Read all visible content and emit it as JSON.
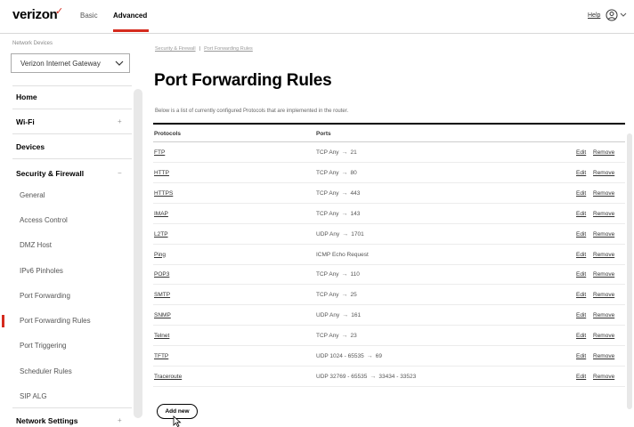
{
  "header": {
    "logo": "verizon",
    "tabs": [
      "Basic",
      "Advanced"
    ],
    "active_tab": "Advanced",
    "help": "Help",
    "brand_color": "#d52b1e"
  },
  "sidebar": {
    "device_label": "Network Devices",
    "device_select": "Verizon Internet Gateway",
    "items": [
      {
        "label": "Home",
        "kind": "head"
      },
      {
        "label": "Wi-Fi",
        "kind": "head",
        "chevron": "+"
      },
      {
        "label": "Devices",
        "kind": "head"
      },
      {
        "label": "Security & Firewall",
        "kind": "head",
        "chevron": "−"
      },
      {
        "label": "General",
        "kind": "sub"
      },
      {
        "label": "Access Control",
        "kind": "sub"
      },
      {
        "label": "DMZ Host",
        "kind": "sub"
      },
      {
        "label": "IPv6 Pinholes",
        "kind": "sub"
      },
      {
        "label": "Port Forwarding",
        "kind": "sub"
      },
      {
        "label": "Port Forwarding Rules",
        "kind": "sub",
        "active": true
      },
      {
        "label": "Port Triggering",
        "kind": "sub"
      },
      {
        "label": "Scheduler Rules",
        "kind": "sub"
      },
      {
        "label": "SIP ALG",
        "kind": "sub"
      },
      {
        "label": "Network Settings",
        "kind": "head",
        "chevron": "+"
      }
    ]
  },
  "main": {
    "breadcrumb": [
      "Security & Firewall",
      "Port Forwarding Rules"
    ],
    "title": "Port Forwarding Rules",
    "description": "Below is a list of currently configured Protocols that are implemented in the router.",
    "columns": [
      "Protocols",
      "Ports"
    ],
    "rows": [
      {
        "protocol": "FTP",
        "from": "TCP Any",
        "to": "21"
      },
      {
        "protocol": "HTTP",
        "from": "TCP Any",
        "to": "80"
      },
      {
        "protocol": "HTTPS",
        "from": "TCP Any",
        "to": "443"
      },
      {
        "protocol": "IMAP",
        "from": "TCP Any",
        "to": "143"
      },
      {
        "protocol": "L2TP",
        "from": "UDP Any",
        "to": "1701"
      },
      {
        "protocol": "Ping",
        "from": "ICMP Echo Request",
        "to": ""
      },
      {
        "protocol": "POP3",
        "from": "TCP Any",
        "to": "110"
      },
      {
        "protocol": "SMTP",
        "from": "TCP Any",
        "to": "25"
      },
      {
        "protocol": "SNMP",
        "from": "UDP Any",
        "to": "161"
      },
      {
        "protocol": "Telnet",
        "from": "TCP Any",
        "to": "23"
      },
      {
        "protocol": "TFTP",
        "from": "UDP 1024 - 65535",
        "to": "69"
      },
      {
        "protocol": "Traceroute",
        "from": "UDP 32769 - 65535",
        "to": "33434 - 33523"
      }
    ],
    "edit_label": "Edit",
    "remove_label": "Remove",
    "add_button": "Add new"
  }
}
